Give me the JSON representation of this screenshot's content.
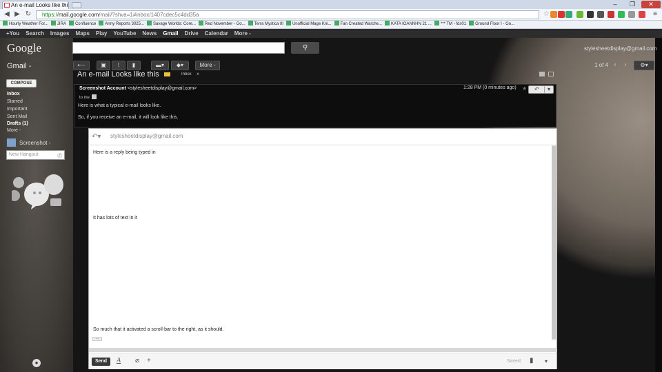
{
  "browser": {
    "tab_title": "An e-mail Looks like this",
    "url_https": "https://",
    "url_host": "mail.google.com",
    "url_rest": "/mail/?shva=1#inbox/1407cdec5c4dd35a",
    "bookmarks": [
      "Hourly Weather For...",
      "JIRA",
      "Confluence",
      "Army Reports 3025...",
      "Savage Worlds: Core...",
      "Red November - Go...",
      "Terra Mystica III",
      "Unofficial Mage Kni...",
      "Fan Created Warche...",
      "KATA IOANNHN 21 ...",
      "*** TM - fds01",
      "Ground Floor I - Go..."
    ]
  },
  "google_bar": {
    "items": [
      "+You",
      "Search",
      "Images",
      "Maps",
      "Play",
      "YouTube",
      "News",
      "Gmail",
      "Drive",
      "Calendar",
      "More -"
    ],
    "active": "Gmail"
  },
  "header": {
    "logo": "Google",
    "account": "stylesheetdisplay@gmail.com",
    "gmail_label": "Gmail -",
    "more_label": "More -",
    "pager": "1 of 4"
  },
  "nav": {
    "compose": "COMPOSE",
    "items": [
      "Inbox",
      "Starred",
      "Important",
      "Sent Mail",
      "Drafts (1)",
      "More -"
    ],
    "chat_user": "Screenshot -",
    "hangout_placeholder": "New Hangout"
  },
  "conversation": {
    "subject": "An e-mail Looks like this",
    "label": "Inbox",
    "label_close": "x",
    "sender_name": "Screenshot Account",
    "sender_email": "<stylesheetdisplay@gmail.com>",
    "to": "to me",
    "time": "1:28 PM (0 minutes ago)",
    "body": [
      "Here is what a typical e-mail looks like.",
      "So, if you receive an e-mail, it will look like this."
    ]
  },
  "reply": {
    "to": "stylesheetdisplay@gmail.com",
    "lines": [
      "Here is a reply being typed in",
      "It has lots of text in it",
      "So much that it activated a scroll-bar to the right, as it should."
    ],
    "ellipsis": "...",
    "send": "Send",
    "saved": "Saved"
  },
  "colors": {
    "bookmark_icon": "#44aa66",
    "label_yellow": "#e9c33c",
    "url_green": "#1a8a1a",
    "topbar": "#2d2d2d"
  }
}
